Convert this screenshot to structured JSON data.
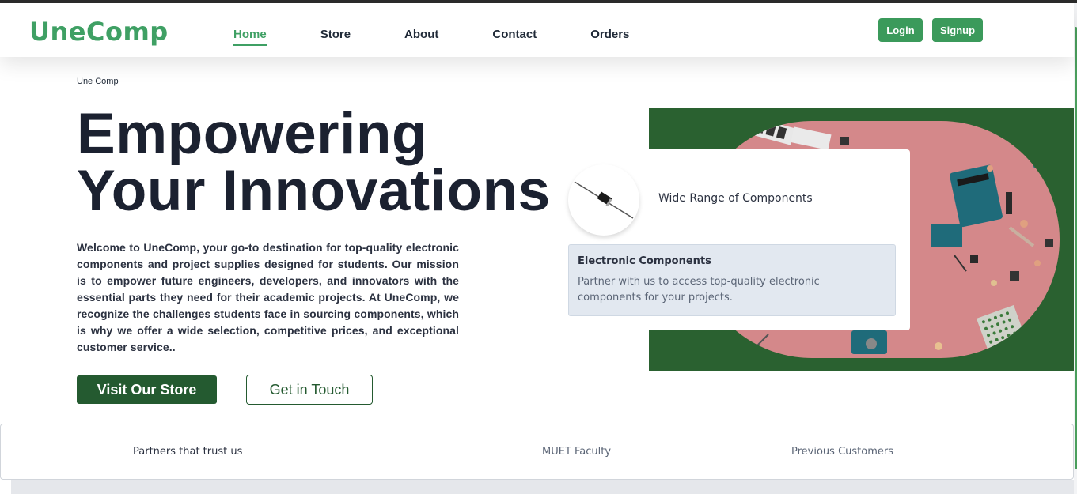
{
  "brand": {
    "logo": "UneComp",
    "accent": "#3fa064",
    "dark_green": "#245a30"
  },
  "nav": {
    "items": [
      {
        "label": "Home",
        "active": true
      },
      {
        "label": "Store",
        "active": false
      },
      {
        "label": "About",
        "active": false
      },
      {
        "label": "Contact",
        "active": false
      },
      {
        "label": "Orders",
        "active": false
      }
    ],
    "login_label": "Login",
    "signup_label": "Signup"
  },
  "breadcrumb": "Une Comp",
  "hero": {
    "title_line1": "Empowering",
    "title_line2": "Your Innovations",
    "description": "Welcome to UneComp, your go-to destination for top-quality electronic components and project supplies designed for students. Our mission is to empower future engineers, developers, and innovators with the essential parts they need for their academic projects. At UneComp, we recognize the challenges students face in sourcing components, which is why we offer a wide selection, competitive prices, and exceptional customer service..",
    "primary_button": "Visit Our Store",
    "secondary_button": "Get in Touch"
  },
  "feature_card": {
    "heading": "Wide Range of Components",
    "inner_title": "Electronic Components",
    "inner_text": "Partner with us to access top-quality electronic components for your projects.",
    "icon": "diode-icon"
  },
  "partners": {
    "label": "Partners that trust us",
    "items": [
      "MUET Faculty",
      "Previous Customers"
    ]
  }
}
